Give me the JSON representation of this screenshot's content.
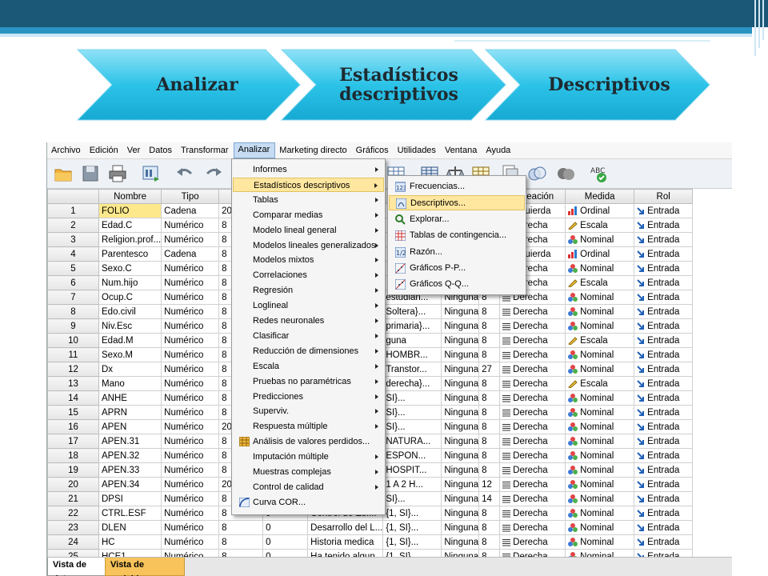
{
  "steps": [
    "Analizar",
    "Estadísticos descriptivos",
    "Descriptivos"
  ],
  "menubar": [
    "Archivo",
    "Edición",
    "Ver",
    "Datos",
    "Transformar",
    "Analizar",
    "Marketing directo",
    "Gráficos",
    "Utilidades",
    "Ventana",
    "Ayuda"
  ],
  "columns": {
    "nombre": "Nombre",
    "tipo": "Tipo",
    "anchura": "Ar",
    "valores": "",
    "perdidos": "",
    "columnas": "as",
    "alineacion": "Alineación",
    "medida": "Medida",
    "rol": "Rol"
  },
  "rows": [
    [
      "1",
      "FOLIO",
      "Cadena",
      "20",
      "",
      "",
      "",
      "",
      "Izquierda",
      "Ordinal",
      "Entrada"
    ],
    [
      "2",
      "Edad.C",
      "Numérico",
      "8",
      "",
      "",
      "",
      "",
      "Derecha",
      "Escala",
      "Entrada"
    ],
    [
      "3",
      "Religion.prof...",
      "Numérico",
      "8",
      "",
      "",
      "",
      "",
      "Derecha",
      "Nominal",
      "Entrada"
    ],
    [
      "4",
      "Parentesco",
      "Cadena",
      "8",
      "",
      "",
      "",
      "",
      "Izquierda",
      "Ordinal",
      "Entrada"
    ],
    [
      "5",
      "Sexo.C",
      "Numérico",
      "8",
      "",
      "",
      "",
      "",
      "Derecha",
      "Nominal",
      "Entrada"
    ],
    [
      "6",
      "Num.hijo",
      "Numérico",
      "8",
      "",
      "",
      "",
      "",
      "Derecha",
      "Escala",
      "Entrada"
    ],
    [
      "7",
      "Ocup.C",
      "Numérico",
      "8",
      "",
      "",
      "estudian...",
      "Ninguna",
      "8",
      "Derecha",
      "Nominal",
      "Entrada"
    ],
    [
      "8",
      "Edo.civil",
      "Numérico",
      "8",
      "",
      "",
      "Soltera}...",
      "Ninguna",
      "8",
      "Derecha",
      "Nominal",
      "Entrada"
    ],
    [
      "9",
      "Niv.Esc",
      "Numérico",
      "8",
      "",
      "",
      "primaria}...",
      "Ninguna",
      "8",
      "Derecha",
      "Nominal",
      "Entrada"
    ],
    [
      "10",
      "Edad.M",
      "Numérico",
      "8",
      "",
      "",
      "guna",
      "Ninguna",
      "8",
      "Derecha",
      "Escala",
      "Entrada"
    ],
    [
      "11",
      "Sexo.M",
      "Numérico",
      "8",
      "",
      "",
      "HOMBR...",
      "Ninguna",
      "8",
      "Derecha",
      "Nominal",
      "Entrada"
    ],
    [
      "12",
      "Dx",
      "Numérico",
      "8",
      "",
      "",
      "Transtor...",
      "Ninguna",
      "27",
      "Derecha",
      "Nominal",
      "Entrada"
    ],
    [
      "13",
      "Mano",
      "Numérico",
      "8",
      "",
      "",
      "derecha}...",
      "Ninguna",
      "8",
      "Derecha",
      "Escala",
      "Entrada"
    ],
    [
      "14",
      "ANHE",
      "Numérico",
      "8",
      "",
      "",
      "SI}...",
      "Ninguna",
      "8",
      "Derecha",
      "Nominal",
      "Entrada"
    ],
    [
      "15",
      "APRN",
      "Numérico",
      "8",
      "",
      "",
      "SI}...",
      "Ninguna",
      "8",
      "Derecha",
      "Nominal",
      "Entrada"
    ],
    [
      "16",
      "APEN",
      "Numérico",
      "20",
      "",
      "",
      "SI}...",
      "Ninguna",
      "8",
      "Derecha",
      "Nominal",
      "Entrada"
    ],
    [
      "17",
      "APEN.31",
      "Numérico",
      "8",
      "",
      "",
      "NATURA...",
      "Ninguna",
      "8",
      "Derecha",
      "Nominal",
      "Entrada"
    ],
    [
      "18",
      "APEN.32",
      "Numérico",
      "8",
      "",
      "",
      "ESPON...",
      "Ninguna",
      "8",
      "Derecha",
      "Nominal",
      "Entrada"
    ],
    [
      "19",
      "APEN.33",
      "Numérico",
      "8",
      "",
      "",
      "HOSPIT...",
      "Ninguna",
      "8",
      "Derecha",
      "Nominal",
      "Entrada"
    ],
    [
      "20",
      "APEN.34",
      "Numérico",
      "20",
      "",
      "",
      "1 A 2 H...",
      "Ninguna",
      "12",
      "Derecha",
      "Nominal",
      "Entrada"
    ],
    [
      "21",
      "DPSI",
      "Numérico",
      "8",
      "",
      "",
      "SI}...",
      "Ninguna",
      "14",
      "Derecha",
      "Nominal",
      "Entrada"
    ],
    [
      "22",
      "CTRL.ESF",
      "Numérico",
      "8",
      "0",
      "Control de Esf...",
      "{1, SI}...",
      "Ninguna",
      "8",
      "Derecha",
      "Nominal",
      "Entrada"
    ],
    [
      "23",
      "DLEN",
      "Numérico",
      "8",
      "0",
      "Desarrollo del L...",
      "{1, SI}...",
      "Ninguna",
      "8",
      "Derecha",
      "Nominal",
      "Entrada"
    ],
    [
      "24",
      "HC",
      "Numérico",
      "8",
      "0",
      "Historia medica",
      "{1, SI}...",
      "Ninguna",
      "8",
      "Derecha",
      "Nominal",
      "Entrada"
    ],
    [
      "25",
      "HCE1",
      "Numérico",
      "8",
      "0",
      "Ha tenido algun...",
      "{1, SI}...",
      "Ninguna",
      "8",
      "Derecha",
      "Nominal",
      "Entrada"
    ]
  ],
  "analizar_menu": [
    "Informes",
    "Estadísticos descriptivos",
    "Tablas",
    "Comparar medias",
    "Modelo lineal general",
    "Modelos lineales generalizados",
    "Modelos mixtos",
    "Correlaciones",
    "Regresión",
    "Loglineal",
    "Redes neuronales",
    "Clasificar",
    "Reducción de dimensiones",
    "Escala",
    "Pruebas no paramétricas",
    "Predicciones",
    "Superviv.",
    "Respuesta múltiple",
    "Análisis de valores perdidos...",
    "Imputación múltiple",
    "Muestras complejas",
    "Control de calidad",
    "Curva COR..."
  ],
  "descriptivos_menu": [
    "Frecuencias...",
    "Descriptivos...",
    "Explorar...",
    "Tablas de contingencia...",
    "Razón...",
    "Gráficos P-P...",
    "Gráficos Q-Q..."
  ],
  "bottom_tabs": [
    "Vista de datos",
    "Vista de variables"
  ],
  "colors": {
    "chevron_fill": "#29c1e6",
    "header_dark": "#1b5776",
    "menu_highlight": "#ffe79f",
    "selected_cell": "#fde98c"
  }
}
